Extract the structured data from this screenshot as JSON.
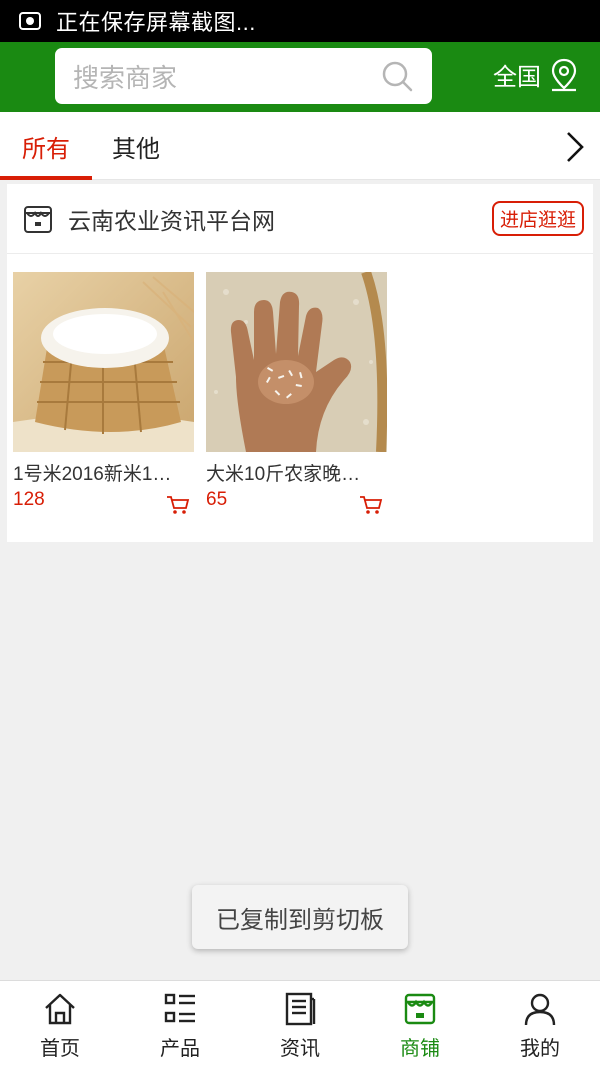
{
  "statusbar": {
    "text": "正在保存屏幕截图..."
  },
  "header": {
    "search_placeholder": "搜索商家",
    "region_label": "全国",
    "colors": {
      "brand_green": "#1a8a12",
      "accent_red": "#d81e06"
    }
  },
  "tabs": [
    {
      "label": "所有",
      "active": true
    },
    {
      "label": "其他",
      "active": false
    }
  ],
  "shop": {
    "name": "云南农业资讯平台网",
    "enter_label": "进店逛逛",
    "products": [
      {
        "title": "1号米2016新米1…",
        "price": "128",
        "icon": "cart-icon"
      },
      {
        "title": "大米10斤农家晚…",
        "price": "65",
        "icon": "cart-icon"
      }
    ]
  },
  "toast": {
    "text": "已复制到剪切板"
  },
  "bottom_nav": [
    {
      "label": "首页",
      "icon": "home-icon"
    },
    {
      "label": "产品",
      "icon": "list-icon"
    },
    {
      "label": "资讯",
      "icon": "news-icon"
    },
    {
      "label": "商铺",
      "icon": "shop-icon",
      "active": true
    },
    {
      "label": "我的",
      "icon": "user-icon"
    }
  ]
}
